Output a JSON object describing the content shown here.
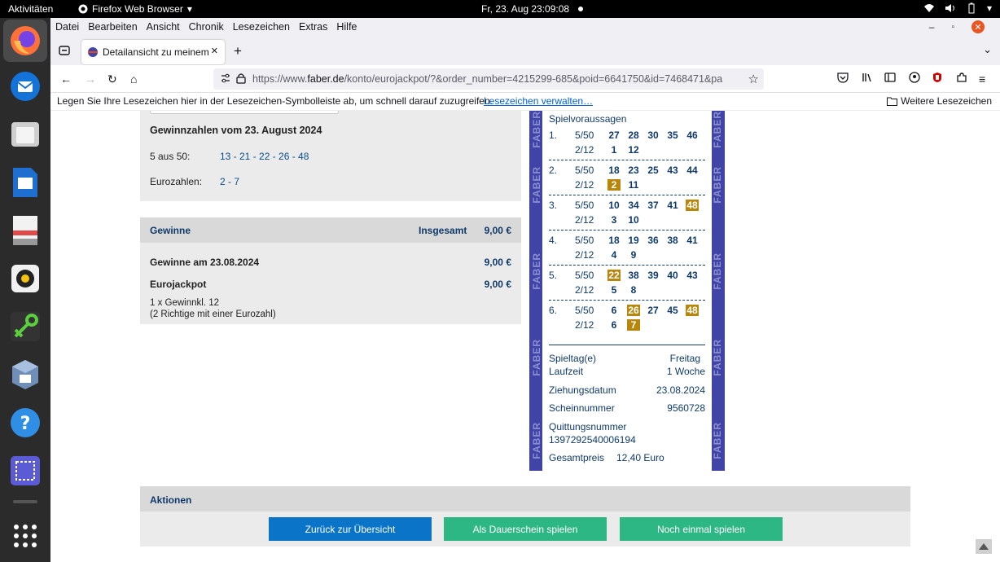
{
  "topbar": {
    "activities": "Aktivitäten",
    "app_name": "Firefox Web Browser",
    "datetime": "Fr, 23. Aug  23:09:08"
  },
  "menu": [
    "Datei",
    "Bearbeiten",
    "Ansicht",
    "Chronik",
    "Lesezeichen",
    "Extras",
    "Hilfe"
  ],
  "tab": {
    "title": "Detailansicht zu meinem"
  },
  "url": {
    "prefix": "https://www.",
    "domain": "faber.de",
    "path": "/konto/eurojackpot/?&order_number=4215299-685&poid=6641750&id=7468471&pa"
  },
  "bookmarks": {
    "hint": "Legen Sie Ihre Lesezeichen hier in der Lesezeichen-Symbolleiste ab, um schnell darauf zuzugreifen.",
    "manage_link": "Lesezeichen verwalten…",
    "other": "Weitere Lesezeichen"
  },
  "winning_numbers": {
    "heading": "Gewinnzahlen vom 23. August 2024",
    "main_label": "5 aus 50:",
    "main_value": "13 - 21 - 22 - 26 - 48",
    "euro_label": "Eurozahlen:",
    "euro_value": "2 - 7"
  },
  "winnings": {
    "header": "Gewinne",
    "total_label": "Insgesamt",
    "total_value": "9,00 €",
    "date_label": "Gewinne am 23.08.2024",
    "date_value": "9,00 €",
    "game_label": "Eurojackpot",
    "game_value": "9,00 €",
    "detail1": "1 x Gewinnkl. 12",
    "detail2": "(2 Richtige mit einer Eurozahl)"
  },
  "ticket": {
    "brand": "FABER",
    "heading": "Spielvoraussagen",
    "rows": [
      {
        "idx": "1.",
        "main_label": "5/50",
        "main": [
          "27",
          "28",
          "30",
          "35",
          "46"
        ],
        "main_hits": [],
        "euro_label": "2/12",
        "euro": [
          "1",
          "12"
        ],
        "euro_hits": []
      },
      {
        "idx": "2.",
        "main_label": "5/50",
        "main": [
          "18",
          "23",
          "25",
          "43",
          "44"
        ],
        "main_hits": [],
        "euro_label": "2/12",
        "euro": [
          "2",
          "11"
        ],
        "euro_hits": [
          0
        ]
      },
      {
        "idx": "3.",
        "main_label": "5/50",
        "main": [
          "10",
          "34",
          "37",
          "41",
          "48"
        ],
        "main_hits": [
          4
        ],
        "euro_label": "2/12",
        "euro": [
          "3",
          "10"
        ],
        "euro_hits": []
      },
      {
        "idx": "4.",
        "main_label": "5/50",
        "main": [
          "18",
          "19",
          "36",
          "38",
          "41"
        ],
        "main_hits": [],
        "euro_label": "2/12",
        "euro": [
          "4",
          "9"
        ],
        "euro_hits": []
      },
      {
        "idx": "5.",
        "main_label": "5/50",
        "main": [
          "22",
          "38",
          "39",
          "40",
          "43"
        ],
        "main_hits": [
          0
        ],
        "euro_label": "2/12",
        "euro": [
          "5",
          "8"
        ],
        "euro_hits": []
      },
      {
        "idx": "6.",
        "main_label": "5/50",
        "main": [
          "6",
          "26",
          "27",
          "45",
          "48"
        ],
        "main_hits": [
          1,
          4
        ],
        "euro_label": "2/12",
        "euro": [
          "6",
          "7"
        ],
        "euro_hits": [
          1
        ]
      }
    ],
    "spieltag_label": "Spieltag(e)",
    "spieltag_value": "Freitag",
    "laufzeit_label": "Laufzeit",
    "laufzeit_value": "1 Woche",
    "ziehung_label": "Ziehungsdatum",
    "ziehung_value": "23.08.2024",
    "schein_label": "Scheinnummer",
    "schein_value": "9560728",
    "quittung_label": "Quittungsnummer",
    "quittung_value": "1397292540006194",
    "preis_label": "Gesamtpreis",
    "preis_value": "12,40 Euro"
  },
  "actions": {
    "heading": "Aktionen",
    "back": "Zurück zur Übersicht",
    "dauerschein": "Als Dauerschein spielen",
    "again": "Noch einmal spielen"
  },
  "colors": {
    "primary_button": "#0a74c9",
    "green_button": "#2db784",
    "ticket_border": "#3f44a6",
    "hit": "#b8860b"
  }
}
